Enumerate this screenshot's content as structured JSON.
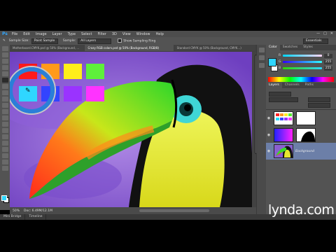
{
  "app": {
    "logo": "Ps"
  },
  "menu": [
    "File",
    "Edit",
    "Image",
    "Layer",
    "Type",
    "Select",
    "Filter",
    "3D",
    "View",
    "Window",
    "Help"
  ],
  "window_controls": [
    "—",
    "□",
    "✕"
  ],
  "options_bar": {
    "sample_size_label": "Sample Size:",
    "sample_size_value": "Point Sample",
    "sample_label": "Sample:",
    "sample_value": "All Layers",
    "show_ring_label": "Show Sampling Ring",
    "workspace_value": "Essentials"
  },
  "doc_tabs": [
    "Motherboard.CMYK.psd @ 50% (Background, ...",
    "Crazy RGB colors.psd @ 50% (Background, RGB/8)",
    "Standard CMYK @ 50% (Background, CMYK...)"
  ],
  "status": {
    "zoom": "50%",
    "doc": "Doc: 6.49M/12.1M"
  },
  "bottom_tabs": [
    "Mini Bridge",
    "Timeline"
  ],
  "color_panel": {
    "tabs": [
      "Color",
      "Swatches",
      "Styles"
    ],
    "sliders": [
      {
        "label": "R",
        "value": "0",
        "gradient": "linear-gradient(90deg,#00d6ff,#ffd6ff)"
      },
      {
        "label": "G",
        "value": "255",
        "gradient": "linear-gradient(90deg,#2f00ff,#2fffff)"
      },
      {
        "label": "B",
        "value": "255",
        "gradient": "linear-gradient(90deg,#2fd600,#2fd6ff)"
      }
    ]
  },
  "layers_panel": {
    "tabs": [
      "Layers",
      "Channels",
      "Paths"
    ],
    "layers": [
      {
        "name": "",
        "kind": "swatch-grid"
      },
      {
        "name": "",
        "kind": "mask"
      },
      {
        "name": "Background",
        "kind": "toucan"
      }
    ]
  },
  "picker_swatches": [
    "#ff1a1a",
    "#ff9a1a",
    "#ffee1a",
    "#5ef03a",
    "#2fd6ff",
    "#3344ff",
    "#9a33ff",
    "#ff33ff"
  ],
  "colors": {
    "accent": "#31a8ff",
    "chrome": "#535353",
    "canvas_bg": "#9b6fd6"
  },
  "watermark": {
    "brand": "lynda",
    "domain": ".com"
  }
}
